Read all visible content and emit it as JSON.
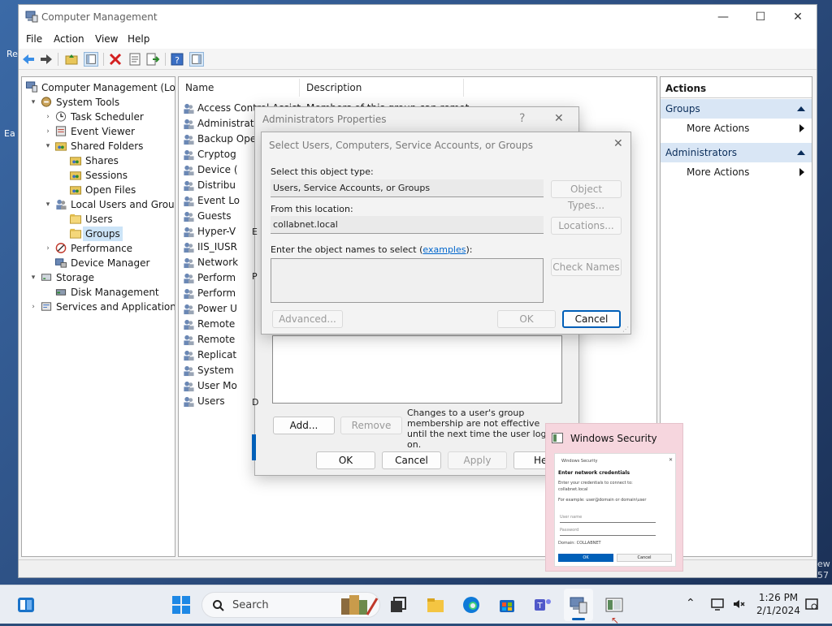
{
  "window": {
    "title": "Computer Management",
    "controls": {
      "minimize": "—",
      "maximize": "☐",
      "close": "✕"
    }
  },
  "menu": [
    "File",
    "Action",
    "View",
    "Help"
  ],
  "tree": [
    {
      "label": "Computer Management (Local",
      "level": 0,
      "expander": "",
      "icon": "computer-management-icon"
    },
    {
      "label": "System Tools",
      "level": 1,
      "expander": "▾",
      "icon": "tools-icon"
    },
    {
      "label": "Task Scheduler",
      "level": 2,
      "expander": "›",
      "icon": "clock-icon"
    },
    {
      "label": "Event Viewer",
      "level": 2,
      "expander": "›",
      "icon": "event-viewer-icon"
    },
    {
      "label": "Shared Folders",
      "level": 2,
      "expander": "▾",
      "icon": "shared-folder-icon"
    },
    {
      "label": "Shares",
      "level": 3,
      "expander": "",
      "icon": "shared-folder-icon"
    },
    {
      "label": "Sessions",
      "level": 3,
      "expander": "",
      "icon": "shared-folder-icon"
    },
    {
      "label": "Open Files",
      "level": 3,
      "expander": "",
      "icon": "shared-folder-icon"
    },
    {
      "label": "Local Users and Groups",
      "level": 2,
      "expander": "▾",
      "icon": "users-icon"
    },
    {
      "label": "Users",
      "level": 3,
      "expander": "",
      "icon": "folder-icon"
    },
    {
      "label": "Groups",
      "level": 3,
      "expander": "",
      "icon": "folder-icon",
      "selected": true
    },
    {
      "label": "Performance",
      "level": 2,
      "expander": "›",
      "icon": "performance-icon"
    },
    {
      "label": "Device Manager",
      "level": 2,
      "expander": "",
      "icon": "device-manager-icon"
    },
    {
      "label": "Storage",
      "level": 1,
      "expander": "▾",
      "icon": "storage-icon"
    },
    {
      "label": "Disk Management",
      "level": 2,
      "expander": "",
      "icon": "disk-icon"
    },
    {
      "label": "Services and Applications",
      "level": 1,
      "expander": "›",
      "icon": "services-icon"
    }
  ],
  "list": {
    "headers": {
      "name": "Name",
      "description": "Description"
    },
    "rows": [
      {
        "name": "Access Control Assist...",
        "description": "Members of this group can remot..."
      },
      {
        "name": "Administrator",
        "description": ""
      },
      {
        "name": "Backup Opera",
        "description": ""
      },
      {
        "name": "Cryptog",
        "description": ""
      },
      {
        "name": "Device (",
        "description": ""
      },
      {
        "name": "Distribu",
        "description": ""
      },
      {
        "name": "Event Lo",
        "description": ""
      },
      {
        "name": "Guests",
        "description": ""
      },
      {
        "name": "Hyper-V",
        "description": ""
      },
      {
        "name": "IIS_IUSR",
        "description": ""
      },
      {
        "name": "Network",
        "description": ""
      },
      {
        "name": "Perform",
        "description": ""
      },
      {
        "name": "Perform",
        "description": ""
      },
      {
        "name": "Power U",
        "description": ""
      },
      {
        "name": "Remote",
        "description": ""
      },
      {
        "name": "Remote",
        "description": ""
      },
      {
        "name": "Replicat",
        "description": ""
      },
      {
        "name": "System",
        "description": ""
      },
      {
        "name": "User Mo",
        "description": ""
      },
      {
        "name": "Users",
        "description": ""
      }
    ]
  },
  "actions": {
    "header": "Actions",
    "sections": [
      {
        "title": "Groups",
        "item": "More Actions"
      },
      {
        "title": "Administrators",
        "item": "More Actions"
      }
    ]
  },
  "props_dialog": {
    "title": "Administrators Properties",
    "help": "?",
    "close": "✕",
    "frag_big": "E",
    "frag_1": "E",
    "frag_2": "P",
    "frag_3": "D",
    "add": "Add...",
    "remove": "Remove",
    "note": "Changes to a user's group membership are not effective until the next time the user logs on.",
    "ok": "OK",
    "cancel": "Cancel",
    "apply": "Apply",
    "help_btn": "He"
  },
  "select_dialog": {
    "title": "Select Users, Computers, Service Accounts, or Groups",
    "close": "✕",
    "object_type_label": "Select this object type:",
    "object_type_value": "Users, Service Accounts, or Groups",
    "object_types_btn": "Object Types...",
    "location_label": "From this location:",
    "location_value": "collabnet.local",
    "locations_btn": "Locations...",
    "names_label_pre": "Enter the object names to select (",
    "names_link": "examples",
    "names_label_post": "):",
    "names_value": "",
    "check_names": "Check Names",
    "advanced": "Advanced...",
    "ok": "OK",
    "cancel": "Cancel"
  },
  "security_thumb": {
    "title": "Windows Security",
    "mini_title": "Windows Security",
    "heading": "Enter network credentials",
    "line1": "Enter your credentials to connect to:",
    "line2": "collabnet.local",
    "line3": "For example: user@domain or domain\\user",
    "user_ph": "User name",
    "pass_ph": "Password",
    "domain": "Domain: COLLABNET",
    "ok": "OK",
    "cancel": "Cancel"
  },
  "desktop_frags": {
    "a": "Re",
    "b": "Ea",
    "c": "ew",
    "d": "57"
  },
  "taskbar": {
    "search_placeholder": "Search",
    "time": "1:26 PM",
    "date": "2/1/2024"
  },
  "colors": {
    "accent": "#005fb8",
    "selection": "#cce4f7",
    "actions_section": "#d9e6f5",
    "thumb_bg": "#f6d6de"
  }
}
